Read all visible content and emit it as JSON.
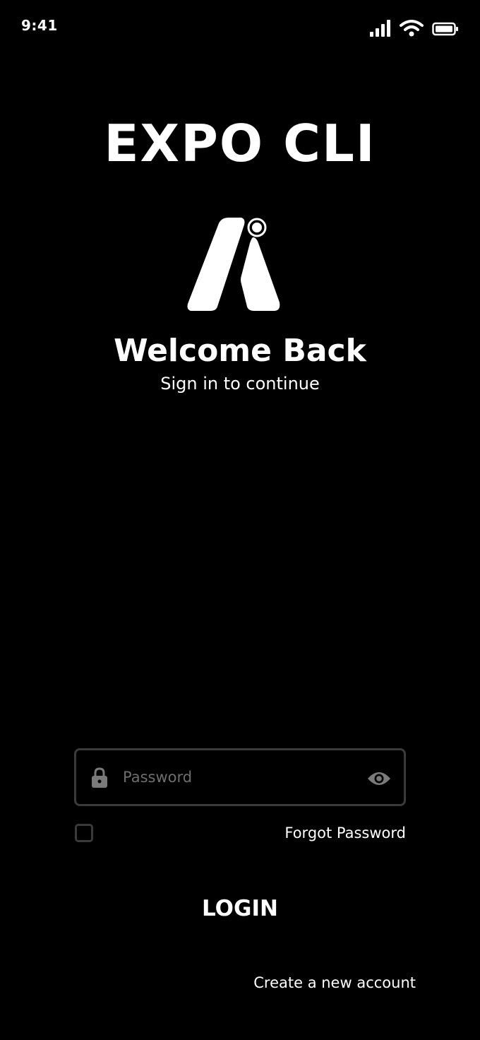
{
  "status_bar": {
    "time": "9:41"
  },
  "app": {
    "title": "EXPO CLI"
  },
  "welcome": {
    "title": "Welcome Back",
    "subtitle": "Sign in to continue"
  },
  "form": {
    "password_placeholder": "Password",
    "password_value": "",
    "remember_checked": false,
    "forgot_label": "Forgot Password",
    "login_label": "LOGIN",
    "create_account_label": "Create a new account"
  },
  "icons": {
    "lock": "lock-icon",
    "eye": "eye-icon",
    "signal": "cellular-signal-icon",
    "wifi": "wifi-icon",
    "battery": "battery-icon"
  },
  "colors": {
    "background": "#000000",
    "text": "#ffffff",
    "field_border": "#3a3a3a",
    "placeholder": "#6e6e6e",
    "icon_muted": "#7a7a7a"
  }
}
